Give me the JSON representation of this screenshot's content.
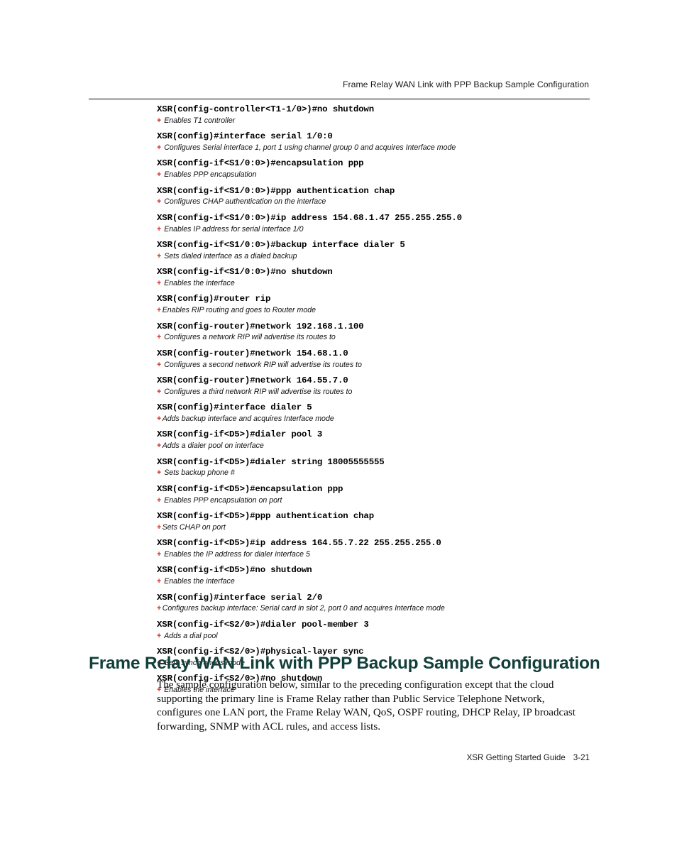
{
  "header": {
    "running_head": "Frame Relay WAN Link with PPP Backup Sample Configuration"
  },
  "cli_blocks": [
    {
      "command": "XSR(config-controller<T1-1/0>)#no shutdown",
      "marker": "+",
      "description": "Enables T1 controller"
    },
    {
      "command": "XSR(config)#interface serial 1/0:0",
      "marker": "+",
      "description": "Configures Serial interface 1, port 1 using channel group 0 and acquires Interface mode"
    },
    {
      "command": "XSR(config-if<S1/0:0>)#encapsulation ppp",
      "marker": "+",
      "description": "Enables PPP encapsulation"
    },
    {
      "command": "XSR(config-if<S1/0:0>)#ppp authentication chap",
      "marker": "+",
      "description": "Configures CHAP authentication on the interface"
    },
    {
      "command": "XSR(config-if<S1/0:0>)#ip address 154.68.1.47 255.255.255.0",
      "marker": "+",
      "description": "Enables IP address for serial interface 1/0"
    },
    {
      "command": "XSR(config-if<S1/0:0>)#backup interface dialer 5",
      "marker": "+",
      "description": "Sets dialed interface as a dialed backup"
    },
    {
      "command": "XSR(config-if<S1/0:0>)#no shutdown",
      "marker": "+",
      "description": "Enables the interface"
    },
    {
      "command": "XSR(config)#router rip",
      "marker": "+",
      "description": "Enables RIP routing and goes to Router mode"
    },
    {
      "command": "XSR(config-router)#network 192.168.1.100",
      "marker": "+",
      "description": "Configures a network RIP will advertise its routes to"
    },
    {
      "command": "XSR(config-router)#network 154.68.1.0",
      "marker": "+",
      "description": "Configures a second network RIP will advertise its routes to"
    },
    {
      "command": "XSR(config-router)#network 164.55.7.0",
      "marker": "+",
      "description": "Configures a third network RIP will advertise its routes to"
    },
    {
      "command": "XSR(config)#interface dialer 5",
      "marker": "+",
      "description": "Adds backup interface and acquires Interface mode"
    },
    {
      "command": "XSR(config-if<D5>)#dialer pool 3",
      "marker": "+",
      "description": "Adds a dialer pool on interface"
    },
    {
      "command": "XSR(config-if<D5>)#dialer string 18005555555",
      "marker": "+",
      "description": "Sets backup phone #"
    },
    {
      "command": "XSR(config-if<D5>)#encapsulation ppp",
      "marker": "+",
      "description": "Enables PPP encapsulation on port"
    },
    {
      "command": "XSR(config-if<D5>)#ppp authentication chap",
      "marker": "+",
      "description": "Sets CHAP on port"
    },
    {
      "command": "XSR(config-if<D5>)#ip address 164.55.7.22 255.255.255.0",
      "marker": "+",
      "description": "Enables the IP address for dialer interface 5"
    },
    {
      "command": "XSR(config-if<D5>)#no shutdown",
      "marker": "+",
      "description": "Enables the interface"
    },
    {
      "command": "XSR(config)#interface serial 2/0",
      "marker": "+",
      "description": "Configures backup interface: Serial card in slot 2, port 0 and acquires Interface mode"
    },
    {
      "command": "XSR(config-if<S2/0>)#dialer pool-member 3",
      "marker": "+",
      "description": "Adds a dial pool"
    },
    {
      "command": "XSR(config-if<S2/0>)#physical-layer sync",
      "marker": "+",
      "description": "Sets synchronous mode"
    },
    {
      "command": "XSR(config-if<S2/0>)#no shutdown",
      "marker": "+",
      "description": "Enables the interface"
    }
  ],
  "section": {
    "heading": "Frame Relay WAN Link with PPP Backup Sample Configuration",
    "paragraph": "The sample configuration below, similar to the preceding configuration except that the cloud supporting the primary line is Frame Relay rather than Public Service Telephone Network, configures one LAN port, the Frame Relay WAN, QoS, OSPF routing, DHCP Relay, IP broadcast forwarding, SNMP with ACL rules, and access lists."
  },
  "footer": {
    "guide_title": "XSR Getting Started Guide",
    "page_number": "3-21"
  },
  "colors": {
    "heading": "#123f3a",
    "marker": "#d42a14",
    "text": "#000000",
    "rule": "#000000"
  }
}
